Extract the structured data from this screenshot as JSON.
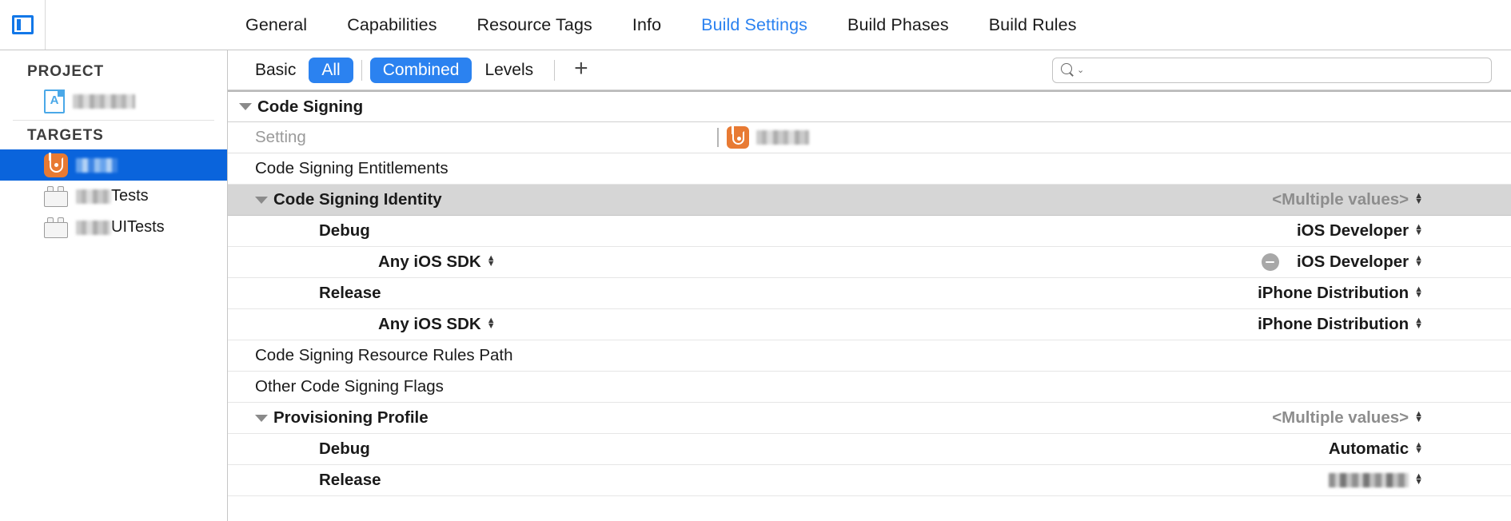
{
  "window": {
    "panel_toggle_icon": "left-panel-toggle-icon"
  },
  "tabs": [
    {
      "label": "General",
      "active": false
    },
    {
      "label": "Capabilities",
      "active": false
    },
    {
      "label": "Resource Tags",
      "active": false
    },
    {
      "label": "Info",
      "active": false
    },
    {
      "label": "Build Settings",
      "active": true
    },
    {
      "label": "Build Phases",
      "active": false
    },
    {
      "label": "Build Rules",
      "active": false
    }
  ],
  "sidebar": {
    "project_heading": "PROJECT",
    "targets_heading": "TARGETS",
    "project_items": [
      {
        "name_redacted": true,
        "icon": "xcode-project-icon"
      }
    ],
    "target_items": [
      {
        "label": "",
        "name_redacted": true,
        "icon": "app-icon-orange-b",
        "selected": true
      },
      {
        "label": "Tests",
        "name_redacted": true,
        "icon": "test-bundle-icon",
        "selected": false
      },
      {
        "label": "UITests",
        "name_redacted": true,
        "icon": "test-bundle-icon",
        "selected": false
      }
    ]
  },
  "filter_bar": {
    "basic_label": "Basic",
    "all_label": "All",
    "combined_label": "Combined",
    "levels_label": "Levels",
    "plus_label": "+",
    "all_selected": true,
    "combined_selected": true
  },
  "search": {
    "value": "",
    "placeholder": "",
    "icon": "search-icon",
    "chevron": "⌄"
  },
  "table": {
    "section_title": "Code Signing",
    "column_setting": "Setting",
    "column_target_redacted": true,
    "rows": [
      {
        "name": "Code Signing Entitlements",
        "value": "",
        "indent": 1,
        "bold": false,
        "triangle": false,
        "selected": false,
        "stepper": false,
        "minus": false
      },
      {
        "name": "Code Signing Identity",
        "value": "<Multiple values>",
        "indent": 1,
        "bold": true,
        "triangle": true,
        "selected": true,
        "stepper": true,
        "minus": false,
        "value_muted": true
      },
      {
        "name": "Debug",
        "value": "iOS Developer",
        "indent": 2,
        "bold": true,
        "triangle": false,
        "selected": false,
        "stepper": true,
        "minus": false
      },
      {
        "name": "Any iOS SDK",
        "value": "iOS Developer",
        "indent": 3,
        "bold": true,
        "triangle": false,
        "selected": false,
        "stepper": true,
        "name_stepper": true,
        "minus": true
      },
      {
        "name": "Release",
        "value": "iPhone Distribution",
        "indent": 2,
        "bold": true,
        "triangle": false,
        "selected": false,
        "stepper": true,
        "minus": false
      },
      {
        "name": "Any iOS SDK",
        "value": "iPhone Distribution",
        "indent": 3,
        "bold": true,
        "triangle": false,
        "selected": false,
        "stepper": true,
        "name_stepper": true,
        "minus": false
      },
      {
        "name": "Code Signing Resource Rules Path",
        "value": "",
        "indent": 1,
        "bold": false,
        "triangle": false,
        "selected": false,
        "stepper": false,
        "minus": false
      },
      {
        "name": "Other Code Signing Flags",
        "value": "",
        "indent": 1,
        "bold": false,
        "triangle": false,
        "selected": false,
        "stepper": false,
        "minus": false
      },
      {
        "name": "Provisioning Profile",
        "value": "<Multiple values>",
        "indent": 1,
        "bold": true,
        "triangle": true,
        "selected": false,
        "stepper": true,
        "minus": false,
        "value_muted": true
      },
      {
        "name": "Debug",
        "value": "Automatic",
        "indent": 2,
        "bold": true,
        "triangle": false,
        "selected": false,
        "stepper": true,
        "minus": false
      },
      {
        "name": "Release",
        "value": "",
        "value_redacted": true,
        "indent": 2,
        "bold": true,
        "triangle": false,
        "selected": false,
        "stepper": true,
        "minus": false
      }
    ]
  }
}
